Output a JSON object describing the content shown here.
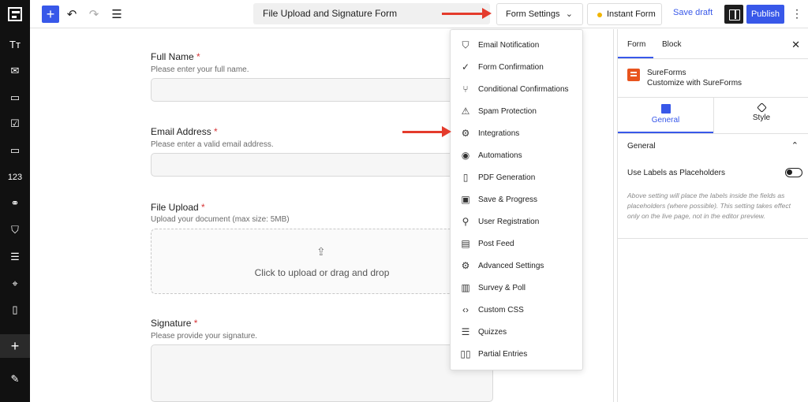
{
  "topbar": {
    "form_title": "File Upload and Signature Form",
    "form_settings_label": "Form Settings",
    "instant_form_label": "Instant Form",
    "save_draft_label": "Save draft",
    "publish_label": "Publish"
  },
  "leftbar": {
    "items": [
      {
        "icon": "typography-icon",
        "glyph": "Tт"
      },
      {
        "icon": "email-icon",
        "glyph": "✉"
      },
      {
        "icon": "textarea-icon",
        "glyph": "▭"
      },
      {
        "icon": "checkbox-icon",
        "glyph": "☑"
      },
      {
        "icon": "button-icon",
        "glyph": "▭"
      },
      {
        "icon": "number-icon",
        "glyph": "123"
      },
      {
        "icon": "link-icon",
        "glyph": "⚭"
      },
      {
        "icon": "shield-icon",
        "glyph": "⛉"
      },
      {
        "icon": "checklist-icon",
        "glyph": "☰"
      },
      {
        "icon": "location-icon",
        "glyph": "⌖"
      },
      {
        "icon": "phone-icon",
        "glyph": "▯"
      },
      {
        "icon": "plus-icon",
        "glyph": "+"
      },
      {
        "icon": "pen-icon",
        "glyph": "✎"
      }
    ]
  },
  "form": {
    "full_name": {
      "label": "Full Name",
      "required_mark": "*",
      "help": "Please enter your full name."
    },
    "email": {
      "label": "Email Address",
      "required_mark": "*",
      "help": "Please enter a valid email address."
    },
    "file_upload": {
      "label": "File Upload",
      "required_mark": "*",
      "help": "Upload your document (max size: 5MB)",
      "dropzone_text": "Click to upload or drag and drop"
    },
    "signature": {
      "label": "Signature",
      "required_mark": "*",
      "help": "Please provide your signature."
    }
  },
  "dropdown": {
    "items": [
      {
        "label": "Email Notification",
        "icon": "shield-check-icon"
      },
      {
        "label": "Form Confirmation",
        "icon": "check-circle-icon"
      },
      {
        "label": "Conditional Confirmations",
        "icon": "branch-icon"
      },
      {
        "label": "Spam Protection",
        "icon": "warning-icon"
      },
      {
        "label": "Integrations",
        "icon": "chip-icon"
      },
      {
        "label": "Automations",
        "icon": "automation-icon"
      },
      {
        "label": "PDF Generation",
        "icon": "document-icon"
      },
      {
        "label": "Save & Progress",
        "icon": "save-icon"
      },
      {
        "label": "User Registration",
        "icon": "user-plus-icon"
      },
      {
        "label": "Post Feed",
        "icon": "post-icon"
      },
      {
        "label": "Advanced Settings",
        "icon": "gear-icon"
      },
      {
        "label": "Survey & Poll",
        "icon": "bar-chart-icon"
      },
      {
        "label": "Custom CSS",
        "icon": "code-icon"
      },
      {
        "label": "Quizzes",
        "icon": "quiz-icon"
      },
      {
        "label": "Partial Entries",
        "icon": "columns-icon"
      }
    ]
  },
  "rightpanel": {
    "tab_form": "Form",
    "tab_block": "Block",
    "brand_name": "SureForms",
    "brand_sub": "Customize with SureForms",
    "subtab_general": "General",
    "subtab_style": "Style",
    "section_title": "General",
    "toggle_label": "Use Labels as Placeholders",
    "help_text": "Above setting will place the labels inside the fields as placeholders (where possible). This setting takes effect only on the live page, not in the editor preview."
  },
  "colors": {
    "accent": "#3858e9",
    "arrow": "#e43b2c",
    "required": "#d63638",
    "brand": "#e8541e"
  }
}
